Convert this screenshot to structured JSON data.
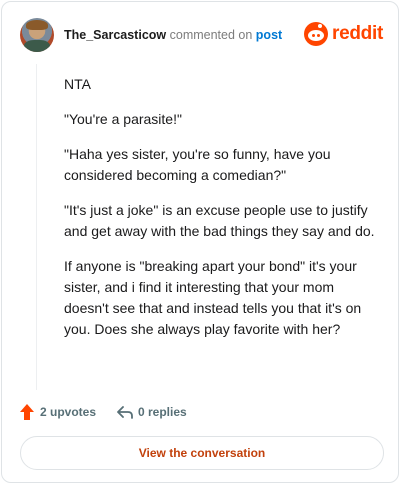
{
  "header": {
    "username": "The_Sarcasticow",
    "verb": "commented on",
    "post_link": "post",
    "logo_text": "reddit",
    "brand_color": "#ff4500"
  },
  "comment": {
    "paragraphs": [
      "NTA",
      "\"You're a parasite!\"",
      "\"Haha yes sister, you're so funny, have you considered becoming a comedian?\"",
      "\"It's just a joke\" is an excuse people use to justify and get away with the bad things they say and do.",
      "If anyone is \"breaking apart your bond\" it's your sister, and i find it interesting that your mom doesn't see that and instead tells you that it's on you. Does she always play favorite with her?"
    ]
  },
  "actions": {
    "upvotes": "2 upvotes",
    "replies": "0 replies",
    "upvote_icon": "upvote-arrow-icon",
    "reply_icon": "reply-arrow-icon"
  },
  "cta": {
    "label": "View the conversation"
  }
}
